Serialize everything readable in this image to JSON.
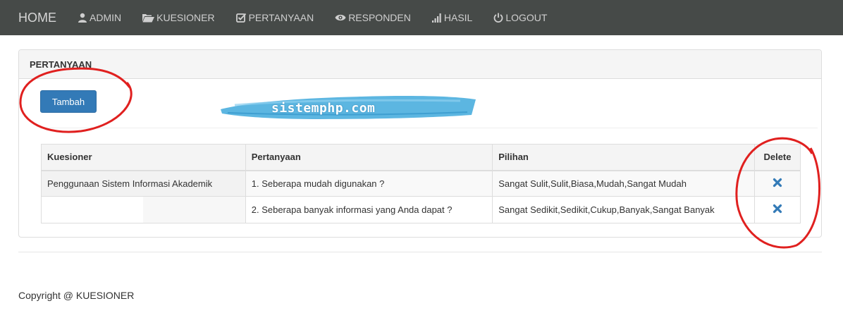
{
  "navbar": {
    "brand": "HOME",
    "items": [
      {
        "label": "ADMIN",
        "icon": "user-icon"
      },
      {
        "label": "KUESIONER",
        "icon": "folder-open-icon"
      },
      {
        "label": "PERTANYAAN",
        "icon": "checkbox-icon"
      },
      {
        "label": "RESPONDEN",
        "icon": "eye-icon"
      },
      {
        "label": "HASIL",
        "icon": "signal-bars-icon"
      },
      {
        "label": "LOGOUT",
        "icon": "power-icon"
      }
    ]
  },
  "panel": {
    "heading": "PERTANYAAN",
    "add_button": "Tambah",
    "watermark": "sistemphp.com"
  },
  "table": {
    "headers": [
      "Kuesioner",
      "Pertanyaan",
      "Pilihan",
      "Delete"
    ],
    "rows": [
      {
        "kuesioner": "Penggunaan Sistem Informasi Akademik",
        "pertanyaan": "1. Seberapa mudah digunakan ?",
        "pilihan": "Sangat Sulit,Sulit,Biasa,Mudah,Sangat Mudah"
      },
      {
        "kuesioner": "",
        "pertanyaan": "2. Seberapa banyak informasi yang Anda dapat ?",
        "pilihan": "Sangat Sedikit,Sedikit,Cukup,Banyak,Sangat Banyak"
      }
    ]
  },
  "footer": {
    "copyright": "Copyright @ KUESIONER"
  },
  "colors": {
    "navbar_bg": "#464a48",
    "primary_button": "#337ab7",
    "delete_icon": "#337ab7",
    "annotation_red": "#e0201f",
    "watermark_blue": "#3fa9dc"
  }
}
